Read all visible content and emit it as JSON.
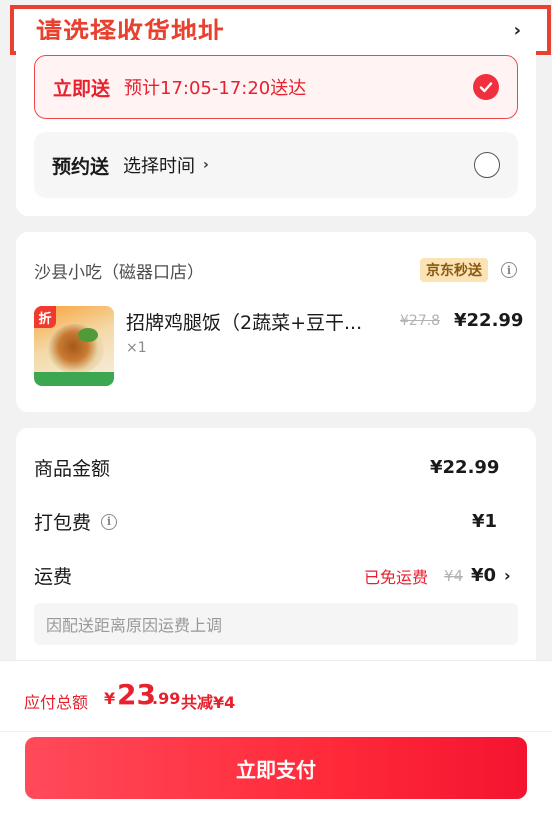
{
  "address": {
    "title": "请选择收货地址",
    "chevron": "›"
  },
  "delivery": {
    "now": {
      "label": "立即送",
      "estimate": "预计17:05-17:20送达",
      "selected": true
    },
    "scheduled": {
      "label": "预约送",
      "action": "选择时间",
      "chevron": "›",
      "selected": false
    }
  },
  "store": {
    "name": "沙县小吃（磁器口店）",
    "badge": "京东秒送",
    "item": {
      "thumb_tag": "折",
      "name": "招牌鸡腿饭（2蔬菜+豆干...",
      "qty": "×1",
      "original_price": "¥27.8",
      "price": "¥22.99"
    }
  },
  "fees": {
    "goods": {
      "label": "商品金额",
      "value": "¥22.99"
    },
    "packing": {
      "label": "打包费",
      "value": "¥1"
    },
    "shipping": {
      "label": "运费",
      "free_text": "已免运费",
      "original": "¥4",
      "value": "¥0",
      "chevron": "›"
    },
    "note": "因配送距离原因运费上调"
  },
  "footer": {
    "total_label": "应付总额",
    "yen": "¥",
    "total_int": "23",
    "total_dec": ".99",
    "saving": "共减¥4",
    "pay_button": "立即支付"
  },
  "colors": {
    "accent": "#e8212f",
    "badge_bg": "#fbe3b5",
    "note_bg": "#f5f5f5"
  }
}
